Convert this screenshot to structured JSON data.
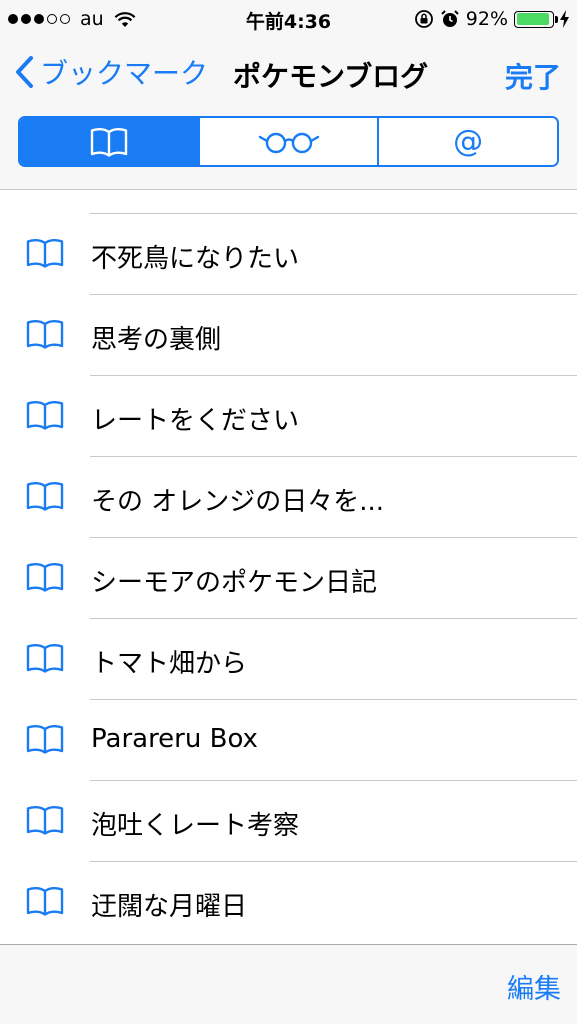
{
  "status": {
    "carrier": "au",
    "time": "午前4:36",
    "battery_text": "92%",
    "battery_level": 0.92
  },
  "nav": {
    "back_label": "ブックマーク",
    "title": "ポケモンブログ",
    "done_label": "完了"
  },
  "segments": [
    {
      "icon": "bookmarks-icon",
      "active": true
    },
    {
      "icon": "reading-list-glasses-icon",
      "active": false
    },
    {
      "label": "@",
      "icon": "shared-links-icon",
      "active": false
    }
  ],
  "bookmarks": [
    {
      "label": "不死鳥になりたい"
    },
    {
      "label": "思考の裏側"
    },
    {
      "label": "レートをください"
    },
    {
      "label": "その オレンジの日々を..."
    },
    {
      "label": "シーモアのポケモン日記"
    },
    {
      "label": "トマト畑から"
    },
    {
      "label": "Parareru Box"
    },
    {
      "label": "泡吐くレート考察"
    },
    {
      "label": "迂闊な月曜日"
    }
  ],
  "toolbar": {
    "edit_label": "編集"
  },
  "colors": {
    "accent": "#1a7cf5",
    "battery": "#4cd964",
    "separator": "#c8c7cc"
  }
}
